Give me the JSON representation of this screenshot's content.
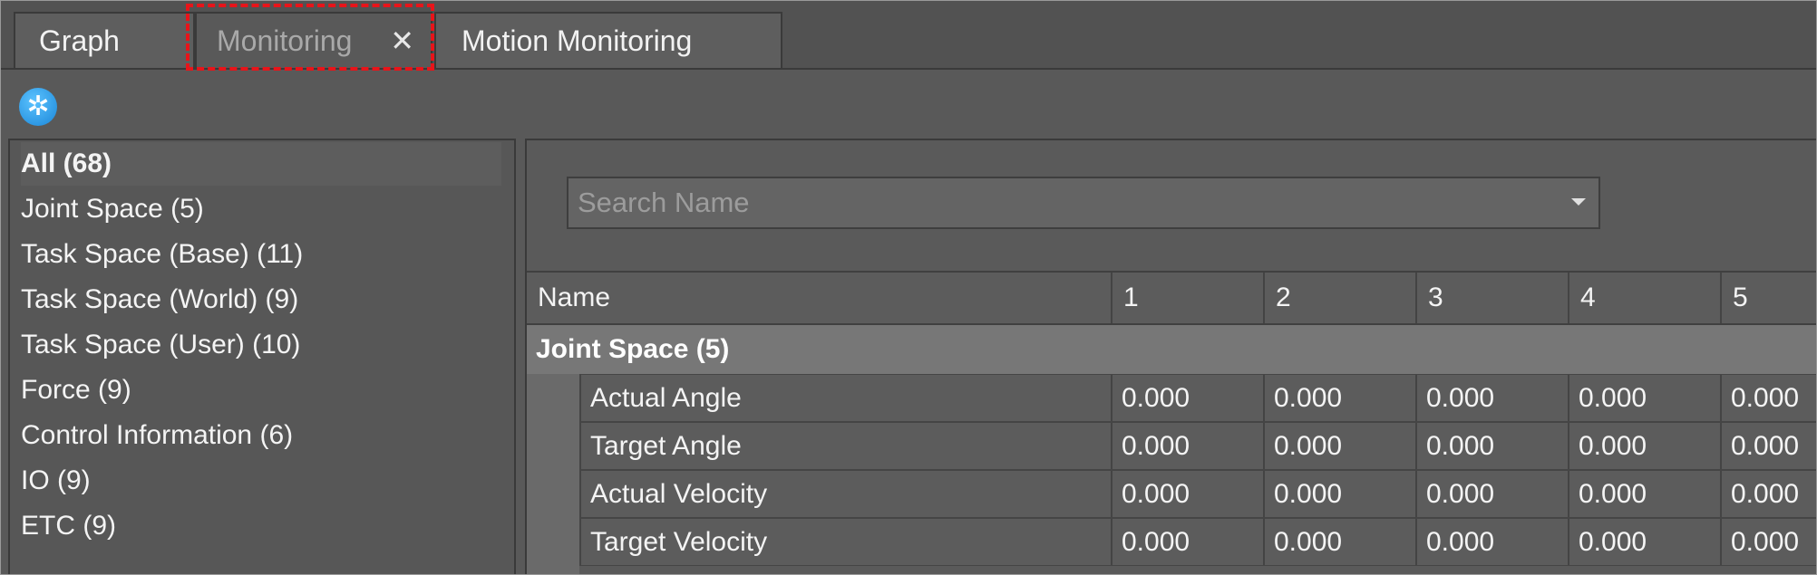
{
  "tabs": [
    {
      "label": "Graph"
    },
    {
      "label": "Monitoring",
      "close_glyph": "✕"
    },
    {
      "label": "Motion Monitoring"
    }
  ],
  "toolbar": {
    "settings_glyph": "✲"
  },
  "categories": [
    {
      "label": "All (68)"
    },
    {
      "label": "Joint Space (5)"
    },
    {
      "label": "Task Space (Base) (11)"
    },
    {
      "label": "Task Space (World) (9)"
    },
    {
      "label": "Task Space (User) (10)"
    },
    {
      "label": "Force (9)"
    },
    {
      "label": "Control Information (6)"
    },
    {
      "label": "IO (9)"
    },
    {
      "label": "ETC (9)"
    }
  ],
  "search": {
    "placeholder": "Search Name"
  },
  "table": {
    "columns": [
      "Name",
      "1",
      "2",
      "3",
      "4",
      "5"
    ],
    "group": "Joint Space (5)",
    "rows": [
      {
        "name": "Actual Angle",
        "values": [
          "0.000",
          "0.000",
          "0.000",
          "0.000",
          "0.000"
        ]
      },
      {
        "name": "Target Angle",
        "values": [
          "0.000",
          "0.000",
          "0.000",
          "0.000",
          "0.000"
        ]
      },
      {
        "name": "Actual Velocity",
        "values": [
          "0.000",
          "0.000",
          "0.000",
          "0.000",
          "0.000"
        ]
      },
      {
        "name": "Target Velocity",
        "values": [
          "0.000",
          "0.000",
          "0.000",
          "0.000",
          "0.000"
        ]
      }
    ]
  },
  "colors": {
    "highlight": "#e8141a",
    "accent": "#1a86d8"
  }
}
